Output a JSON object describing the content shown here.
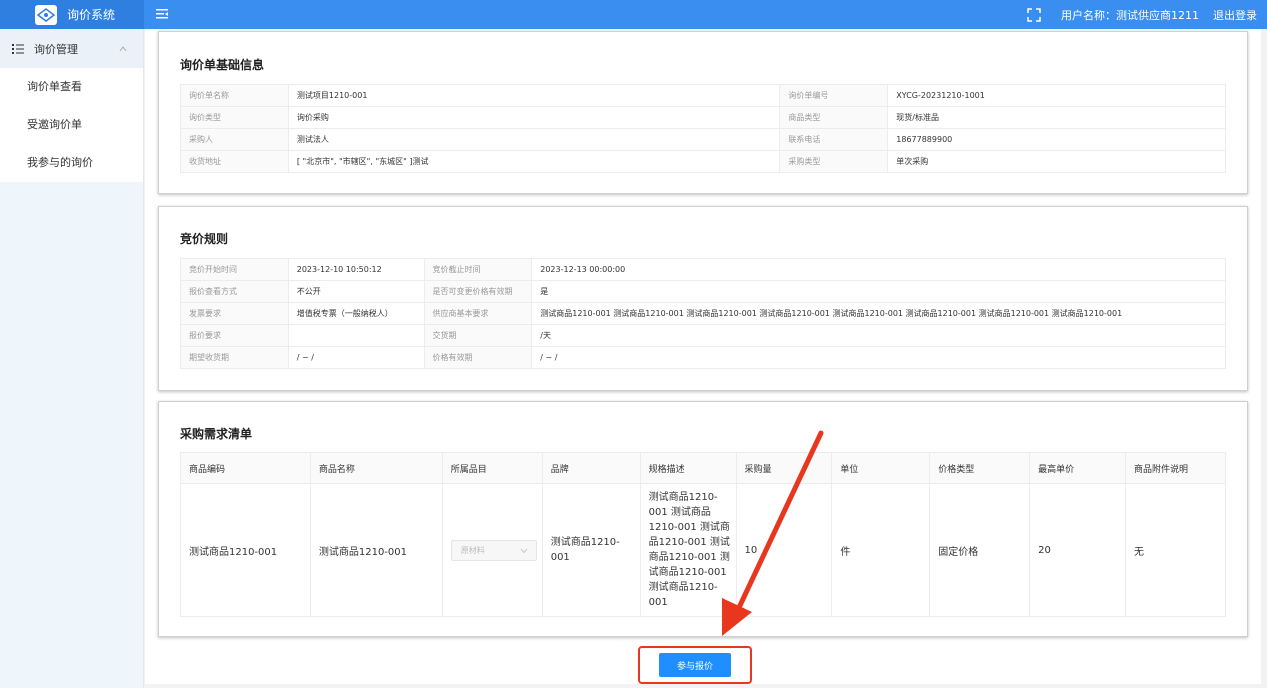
{
  "app": {
    "title": "询价系统"
  },
  "header": {
    "user_label": "用户名称：测试供应商1211",
    "logout": "退出登录"
  },
  "sidebar": {
    "group": "询价管理",
    "items": [
      {
        "label": "询价单查看"
      },
      {
        "label": "受邀询价单"
      },
      {
        "label": "我参与的询价"
      }
    ]
  },
  "basic": {
    "title": "询价单基础信息",
    "rows": [
      {
        "k1": "询价单名称",
        "v1": "测试项目1210-001",
        "k2": "询价单编号",
        "v2": "XYCG-20231210-1001"
      },
      {
        "k1": "询价类型",
        "v1": "询价采购",
        "k2": "商品类型",
        "v2": "现货/标准品"
      },
      {
        "k1": "采购人",
        "v1": "测试法人",
        "k2": "联系电话",
        "v2": "18677889900"
      },
      {
        "k1": "收货地址",
        "v1": "[ \"北京市\", \"市辖区\", \"东城区\" ]测试",
        "k2": "采购类型",
        "v2": "单次采购"
      }
    ]
  },
  "rules": {
    "title": "竞价规则",
    "rows": [
      {
        "k1": "竞价开始时间",
        "v1": "2023-12-10 10:50:12",
        "k2": "竞价截止时间",
        "v2": "2023-12-13 00:00:00"
      },
      {
        "k1": "报价查看方式",
        "v1": "不公开",
        "k2": "是否可变更价格有效期",
        "v2": "是"
      },
      {
        "k1": "发票要求",
        "v1": "增值税专票（一般纳税人）",
        "k2": "供应商基本要求",
        "v2": "测试商品1210-001 测试商品1210-001 测试商品1210-001 测试商品1210-001 测试商品1210-001 测试商品1210-001 测试商品1210-001 测试商品1210-001"
      },
      {
        "k1": "报价要求",
        "v1": "",
        "k2": "交货期",
        "v2": "/天"
      },
      {
        "k1": "期望收货期",
        "v1": "/ ~ /",
        "k2": "价格有效期",
        "v2": "/ ~ /"
      }
    ]
  },
  "demand": {
    "title": "采购需求清单",
    "headers": [
      "商品编码",
      "商品名称",
      "所属品目",
      "品牌",
      "规格描述",
      "采购量",
      "单位",
      "价格类型",
      "最高单价",
      "商品附件说明"
    ],
    "row": {
      "code": "测试商品1210-001",
      "name": "测试商品1210-001",
      "category": "原材料",
      "brand": "测试商品1210-001",
      "spec": "测试商品1210-001 测试商品1210-001 测试商品1210-001 测试商品1210-001 测试商品1210-001 测试商品1210-001",
      "qty": "10",
      "unit": "件",
      "price_type": "固定价格",
      "max_price": "20",
      "attachment": "无"
    }
  },
  "actions": {
    "submit": "参与报价"
  },
  "colors": {
    "header": "#3a8ef0",
    "primary": "#1f8fff",
    "highlight": "#e8361f"
  }
}
